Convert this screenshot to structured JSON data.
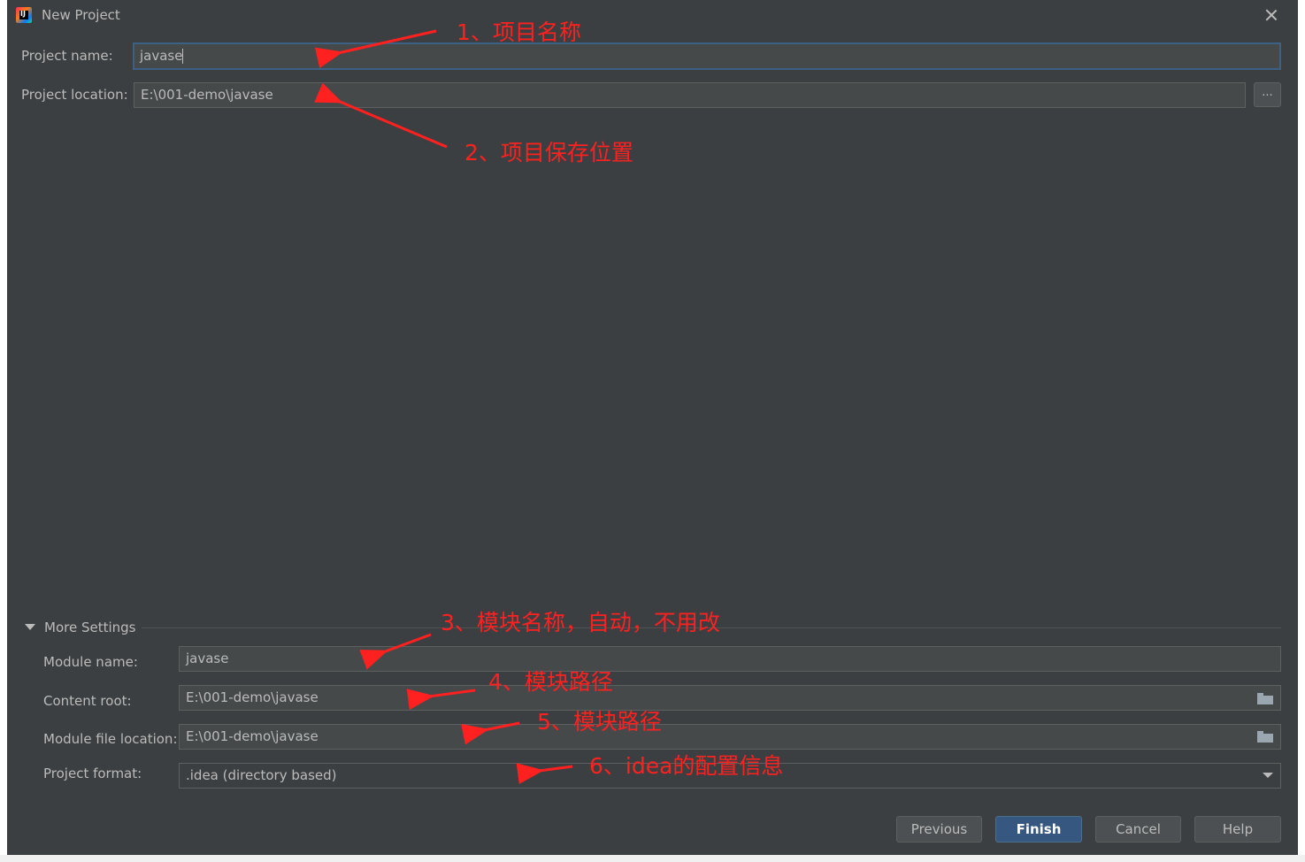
{
  "window": {
    "title": "New Project"
  },
  "project": {
    "name_label": "Project name:",
    "name_value": "javase",
    "location_label": "Project location:",
    "location_value": "E:\\001-demo\\javase",
    "browse_label": "..."
  },
  "more_settings": {
    "title": "More Settings",
    "module_name_label": "Module name:",
    "module_name_value": "javase",
    "content_root_label": "Content root:",
    "content_root_value": "E:\\001-demo\\javase",
    "module_file_label": "Module file location:",
    "module_file_value": "E:\\001-demo\\javase",
    "format_label": "Project format:",
    "format_value": ".idea (directory based)"
  },
  "buttons": {
    "previous": "Previous",
    "finish": "Finish",
    "cancel": "Cancel",
    "help": "Help"
  },
  "annotations": {
    "a1": "1、项目名称",
    "a2": "2、项目保存位置",
    "a3": "3、模块名称，自动，不用改",
    "a4": "4、模块路径",
    "a5": "5、模块路径",
    "a6": "6、idea的配置信息"
  },
  "colors": {
    "dialog_bg": "#3c3f41",
    "field_bg": "#45494a",
    "accent": "#365880",
    "annotation": "#ff2020"
  }
}
